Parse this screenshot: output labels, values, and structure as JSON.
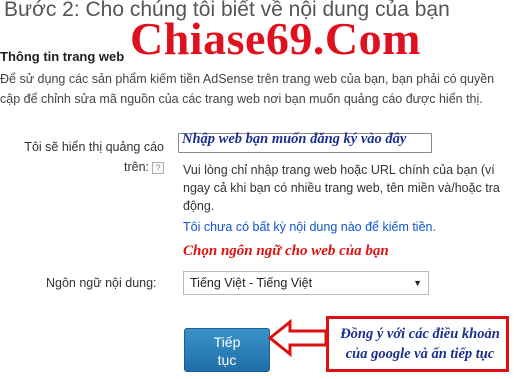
{
  "step_title": "Bước 2: Cho chúng tôi biết về nội dung của bạn",
  "watermark": "Chiase69.Com",
  "section": {
    "title": "Thông tin trang web",
    "intro_lines": [
      "Để sử dụng các sản phẩm kiếm tiền AdSense trên trang web của bạn, bạn phải có quyền",
      "cập để chỉnh sửa mã nguồn của các trang web nơi bạn muốn quảng cáo được hiển thị."
    ]
  },
  "site_field": {
    "label_line1": "Tôi sẽ hiển thị quảng cáo",
    "label_line2": "trên:",
    "help_icon": "?",
    "annotation": "Nhập web bạn muốn đăng ký vào đây",
    "help_lines": [
      "Vui lòng chỉ nhập trang web hoặc URL chính của bạn (ví",
      "ngay cả khi bạn có nhiều trang web, tên miền và/hoặc tra",
      "động."
    ],
    "no_site_link": "Tôi chưa có bất kỳ nội dung nào để kiếm tiền."
  },
  "language": {
    "annotation": "Chọn ngôn ngữ cho web của bạn",
    "label": "Ngôn ngữ nội dung:",
    "selected": "Tiếng Việt - Tiếng Việt"
  },
  "continue_button": {
    "line1": "Tiếp",
    "line2": "tục"
  },
  "agree_note": {
    "line1": "Đồng ý với các điều khoản",
    "line2": "của google và ấn tiếp tục"
  },
  "colors": {
    "annotation_red": "#e01010",
    "annotation_blue": "#1a2f8f",
    "link_blue": "#1155cc",
    "button_blue": "#2a7fba"
  }
}
